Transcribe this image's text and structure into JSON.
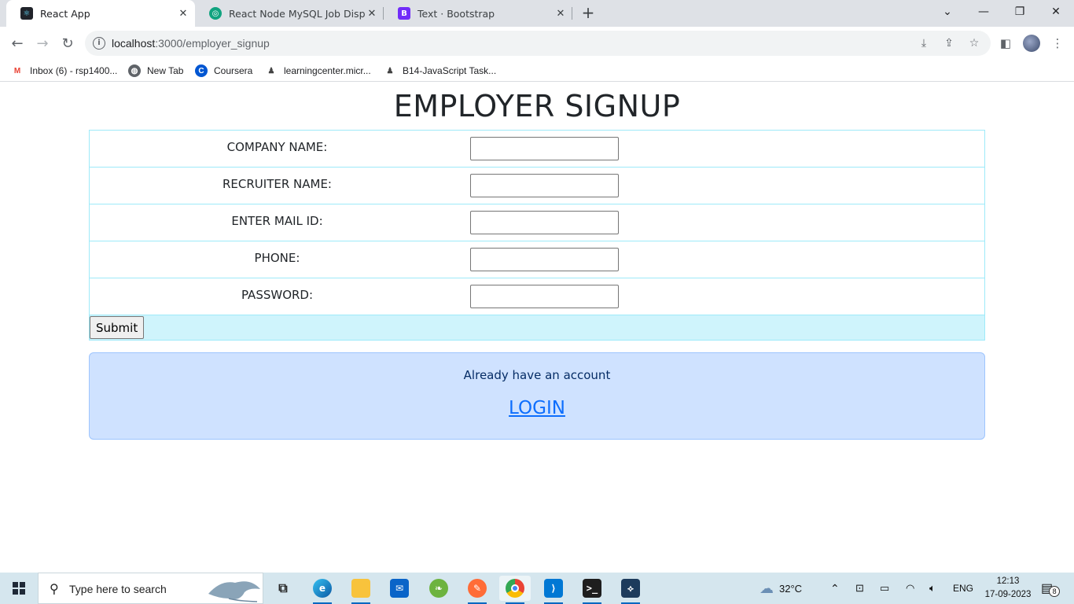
{
  "browser": {
    "tabs": [
      {
        "title": "React App",
        "active": true
      },
      {
        "title": "React Node MySQL Job Display",
        "active": false
      },
      {
        "title": "Text · Bootstrap",
        "active": false
      }
    ],
    "new_tab_symbol": "+",
    "window_controls": {
      "dropdown": "⌄",
      "minimize": "—",
      "restore": "❐",
      "close": "✕"
    },
    "address": {
      "host": "localhost",
      "path": ":3000/employer_signup"
    },
    "bookmarks": [
      {
        "label": "Inbox (6) - rsp1400...",
        "icon": "gmail-icon"
      },
      {
        "label": "New Tab",
        "icon": "globe-icon"
      },
      {
        "label": "Coursera",
        "icon": "coursera-icon"
      },
      {
        "label": "learningcenter.micr...",
        "icon": "person-icon"
      },
      {
        "label": "B14-JavaScript Task...",
        "icon": "person-icon"
      }
    ]
  },
  "page": {
    "title": "EMPLOYER SIGNUP",
    "fields": [
      {
        "label": "COMPANY NAME:",
        "value": ""
      },
      {
        "label": "RECRUITER NAME:",
        "value": ""
      },
      {
        "label": "ENTER MAIL ID:",
        "value": ""
      },
      {
        "label": "PHONE:",
        "value": ""
      },
      {
        "label": "PASSWORD:",
        "value": ""
      }
    ],
    "submit_label": "Submit",
    "login_prompt": "Already have an account",
    "login_link": "LOGIN",
    "colors": {
      "table_border": "#9eeaf9",
      "submit_row_bg": "#cff4fc",
      "login_box_bg": "#cfe2ff",
      "login_link": "#0d6efd"
    }
  },
  "taskbar": {
    "search_placeholder": "Type here to search",
    "weather": "32°C",
    "language": "ENG",
    "time": "12:13",
    "date": "17-09-2023",
    "notification_count": "8"
  }
}
